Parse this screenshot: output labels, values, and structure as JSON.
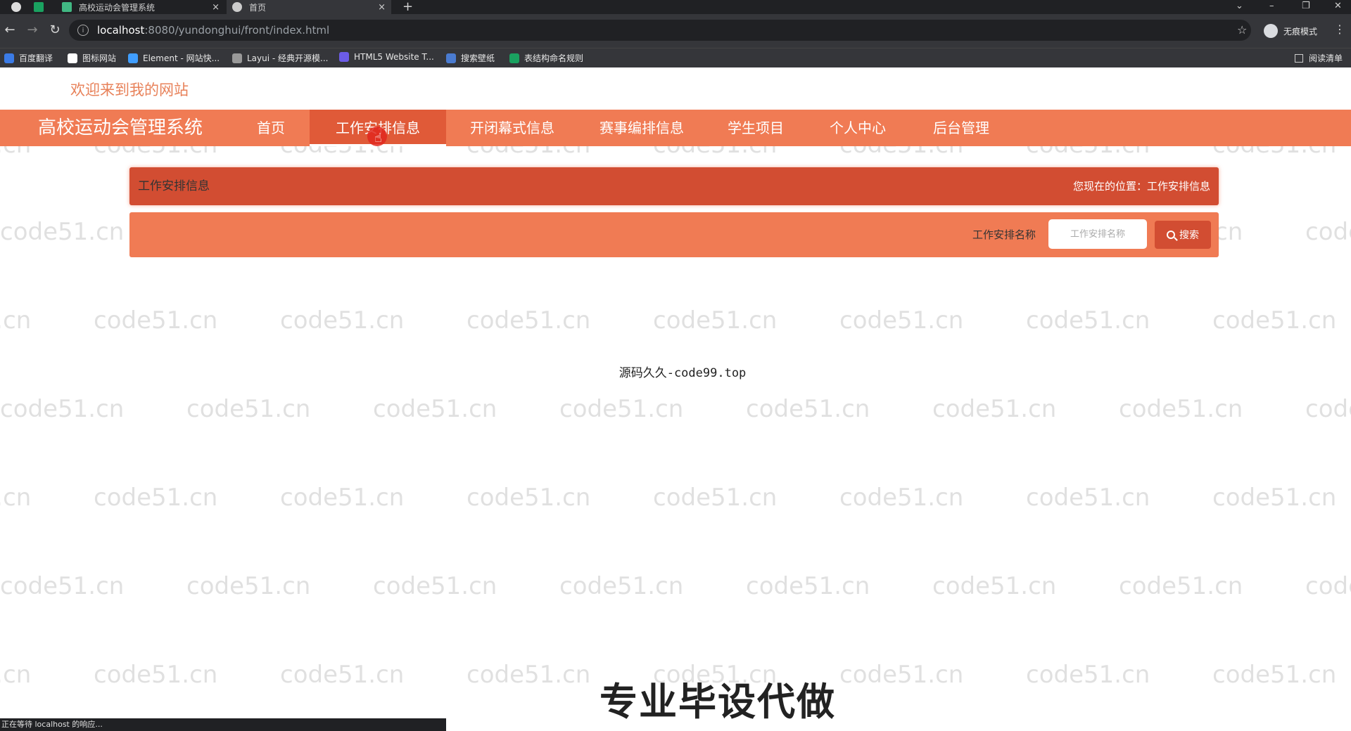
{
  "browser": {
    "tabs": [
      {
        "title": ""
      },
      {
        "title": ""
      },
      {
        "title": "高校运动会管理系统"
      },
      {
        "title": "首页"
      }
    ],
    "new_tab": "+",
    "close_glyph": "×",
    "url_host": "localhost",
    "url_path": ":8080/yundonghui/front/index.html",
    "incognito_label": "无痕模式",
    "bookmarks": [
      {
        "label": "百度翻译",
        "color": "#3b7be6"
      },
      {
        "label": "图标网站",
        "color": "#ffffff"
      },
      {
        "label": "Element - 网站快...",
        "color": "#409eff"
      },
      {
        "label": "Layui - 经典开源模...",
        "color": "#999999"
      },
      {
        "label": "HTML5 Website T...",
        "color": "#6c5ce7"
      },
      {
        "label": "搜索壁纸",
        "color": "#4a7bd0"
      },
      {
        "label": "表结构命名规则",
        "color": "#1aa260"
      }
    ],
    "reading_list": "阅读清单",
    "status_text": "正在等待 localhost 的响应..."
  },
  "site": {
    "welcome": "欢迎来到我的网站",
    "brand": "高校运动会管理系统",
    "nav": [
      {
        "label": "首页"
      },
      {
        "label": "工作安排信息"
      },
      {
        "label": "开闭幕式信息"
      },
      {
        "label": "赛事编排信息"
      },
      {
        "label": "学生项目"
      },
      {
        "label": "个人中心"
      },
      {
        "label": "后台管理"
      }
    ],
    "active_nav": "工作安排信息",
    "crumb_title": "工作安排信息",
    "crumb_location": "您现在的位置：工作安排信息",
    "search_label": "工作安排名称",
    "search_placeholder": "工作安排名称",
    "search_button": "搜索",
    "center_text": "源码久久-code99.top",
    "promo_text": "专业毕设代做",
    "watermark": "code51.cn"
  },
  "colors": {
    "nav_bg": "#f07b54",
    "nav_active": "#e05a38",
    "crumb_bg": "#d24d32",
    "welcome_text": "#e8825a"
  }
}
